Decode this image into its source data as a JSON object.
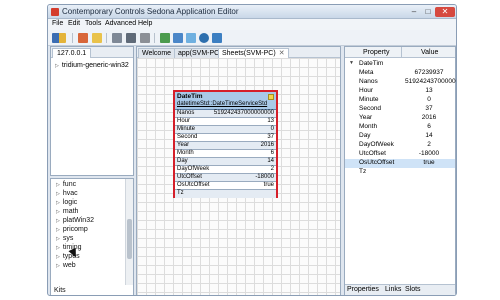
{
  "window": {
    "title": "Contemporary Controls Sedona Application Editor"
  },
  "menu": [
    "File",
    "Edit",
    "Tools",
    "Advanced",
    "Help"
  ],
  "left_top": {
    "tab": "127.0.0.1",
    "tree_item": "tridium-generic-win32"
  },
  "kits": {
    "items": [
      "func",
      "hvac",
      "logic",
      "math",
      "platWin32",
      "pricomp",
      "sys",
      "timing",
      "types",
      "web"
    ],
    "tab_label": "Kits"
  },
  "editor": {
    "tabs": [
      {
        "label": "Welcome",
        "close": ""
      },
      {
        "label": "app(SVM-PC)",
        "close": ""
      },
      {
        "label": "Sheets(SVM-PC)",
        "close": "✕"
      }
    ],
    "component": {
      "name": "DateTim",
      "type": "datetimeStd::DateTimeServiceStd",
      "slots": [
        {
          "name": "Nanos",
          "value": "519242437000000000"
        },
        {
          "name": "Hour",
          "value": "13"
        },
        {
          "name": "Minute",
          "value": "0"
        },
        {
          "name": "Second",
          "value": "37"
        },
        {
          "name": "Year",
          "value": "2016"
        },
        {
          "name": "Month",
          "value": "6"
        },
        {
          "name": "Day",
          "value": "14"
        },
        {
          "name": "DayOfWeek",
          "value": "2"
        },
        {
          "name": "UtcOffset",
          "value": "-18000"
        },
        {
          "name": "OsUtcOffset",
          "value": "true"
        },
        {
          "name": "Tz",
          "value": ""
        }
      ]
    }
  },
  "properties": {
    "headers": {
      "property": "Property",
      "value": "Value"
    },
    "group_label": "DateTim",
    "rows": [
      {
        "name": "Meta",
        "value": "67239937"
      },
      {
        "name": "Nanos",
        "value": "519242437000000"
      },
      {
        "name": "Hour",
        "value": "13"
      },
      {
        "name": "Minute",
        "value": "0"
      },
      {
        "name": "Second",
        "value": "37"
      },
      {
        "name": "Year",
        "value": "2016"
      },
      {
        "name": "Month",
        "value": "6"
      },
      {
        "name": "Day",
        "value": "14"
      },
      {
        "name": "DayOfWeek",
        "value": "2"
      },
      {
        "name": "UtcOffset",
        "value": "-18000"
      },
      {
        "name": "OsUtcOffset",
        "value": "true"
      },
      {
        "name": "Tz",
        "value": ""
      }
    ],
    "selected_row": "OsUtcOffset",
    "bottom_tabs": [
      "Properties",
      "Links",
      "Slots"
    ]
  },
  "colors": {
    "selection_border": "#d51f2a",
    "component_header": "#a9c9e8",
    "selected_row": "#cfe3f7"
  }
}
